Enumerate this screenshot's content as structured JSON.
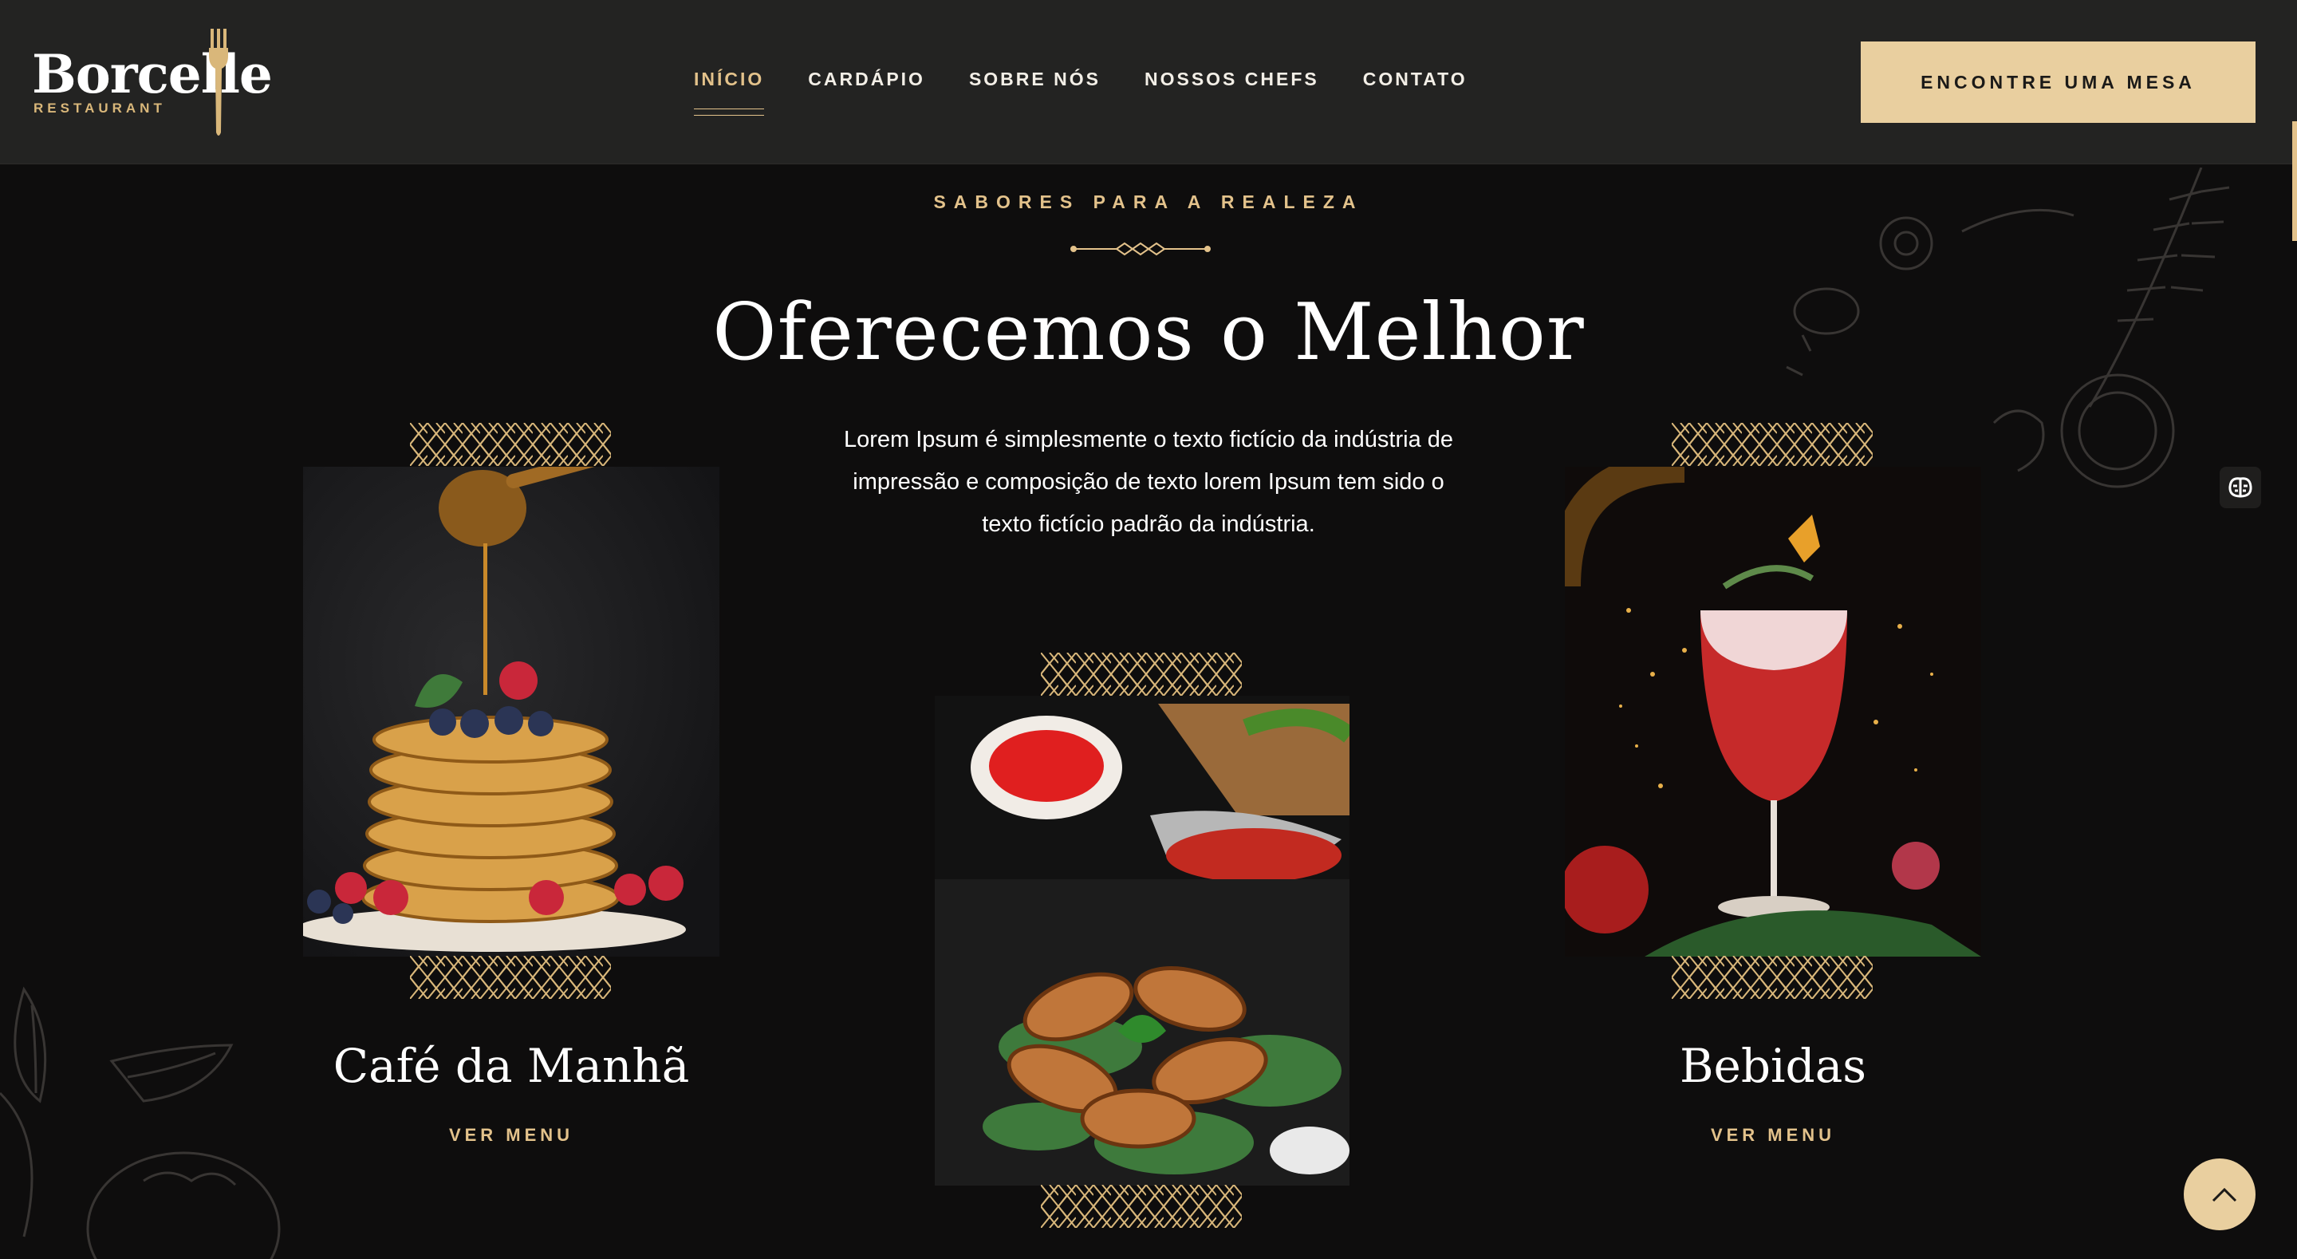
{
  "brand": {
    "name": "Borcelle",
    "tagline": "RESTAURANT"
  },
  "nav": {
    "items": [
      {
        "label": "INÍCIO",
        "active": true
      },
      {
        "label": "CARDÁPIO",
        "active": false
      },
      {
        "label": "SOBRE NÓS",
        "active": false
      },
      {
        "label": "NOSSOS CHEFS",
        "active": false
      },
      {
        "label": "CONTATO",
        "active": false
      }
    ],
    "cta_label": "ENCONTRE UMA MESA"
  },
  "hero": {
    "eyebrow": "SABORES PARA A REALEZA",
    "title": "Oferecemos o Melhor",
    "description": "Lorem Ipsum é simplesmente o texto fictício da indústria de impressão e composição de texto lorem Ipsum tem sido o texto fictício padrão da indústria."
  },
  "cards": [
    {
      "title": "Café da Manhã",
      "link": "VER MENU",
      "image": "pancakes-with-honey-and-berries"
    },
    {
      "title": "",
      "link": "",
      "image": "grilled-chicken-wings-with-sauce"
    },
    {
      "title": "Bebidas",
      "link": "VER MENU",
      "image": "red-cocktail-in-wine-glass"
    }
  ],
  "colors": {
    "accent": "#e3c28b",
    "button": "#e9cf9f",
    "header": "#232322",
    "background": "#0e0d0d"
  },
  "icons": [
    "fork-icon",
    "brain-icon",
    "chevron-up-icon"
  ]
}
